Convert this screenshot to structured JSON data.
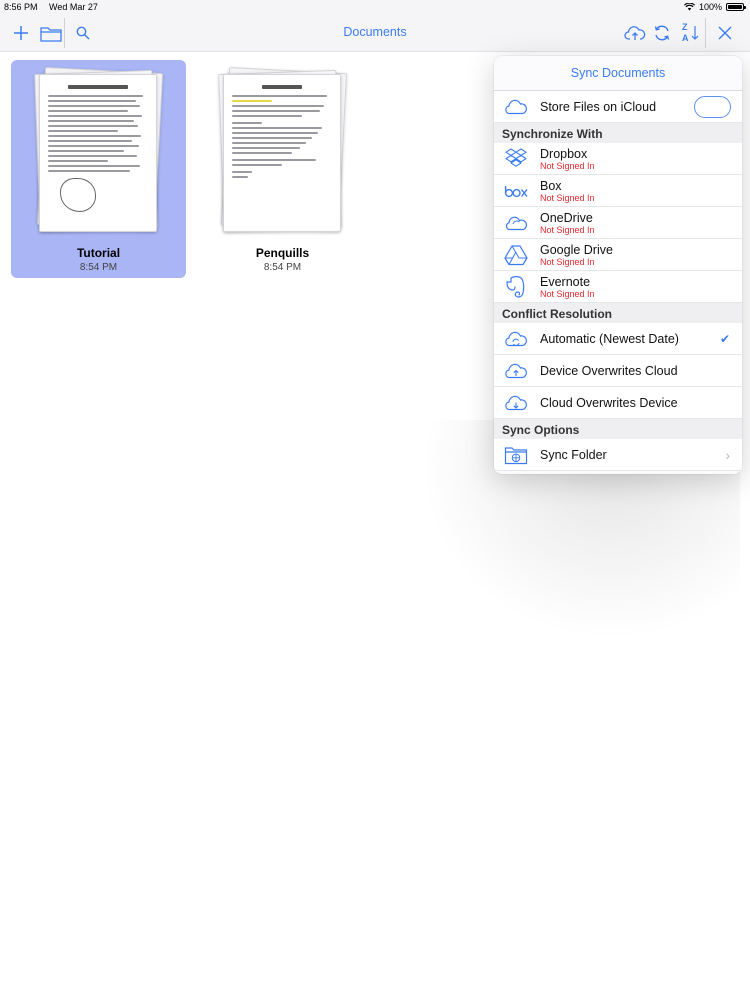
{
  "status": {
    "time": "8:56 PM",
    "date": "Wed Mar 27",
    "battery": "100%"
  },
  "toolbar": {
    "title": "Documents",
    "sort_label_top": "Z",
    "sort_label_bottom": "A"
  },
  "documents": [
    {
      "name": "Tutorial",
      "time": "8:54 PM",
      "selected": true
    },
    {
      "name": "Penquills",
      "time": "8:54 PM",
      "selected": false
    }
  ],
  "sync": {
    "title": "Sync Documents",
    "icloud": {
      "label": "Store Files on iCloud",
      "enabled": false
    },
    "sections": {
      "synchronize_with": "Synchronize With",
      "conflict_resolution": "Conflict Resolution",
      "sync_options": "Sync Options"
    },
    "services": [
      {
        "name": "Dropbox",
        "status": "Not Signed In",
        "icon": "dropbox-icon"
      },
      {
        "name": "Box",
        "status": "Not Signed In",
        "icon": "box-icon"
      },
      {
        "name": "OneDrive",
        "status": "Not Signed In",
        "icon": "onedrive-icon"
      },
      {
        "name": "Google Drive",
        "status": "Not Signed In",
        "icon": "google-drive-icon"
      },
      {
        "name": "Evernote",
        "status": "Not Signed In",
        "icon": "evernote-icon"
      }
    ],
    "conflict": [
      {
        "label": "Automatic (Newest Date)",
        "checked": true
      },
      {
        "label": "Device Overwrites Cloud",
        "checked": false
      },
      {
        "label": "Cloud Overwrites Device",
        "checked": false
      }
    ],
    "options": [
      {
        "label": "Sync Folder"
      }
    ]
  },
  "colors": {
    "accent": "#3b7cf2",
    "selection": "#a9b5f5",
    "error": "#e0282e"
  }
}
